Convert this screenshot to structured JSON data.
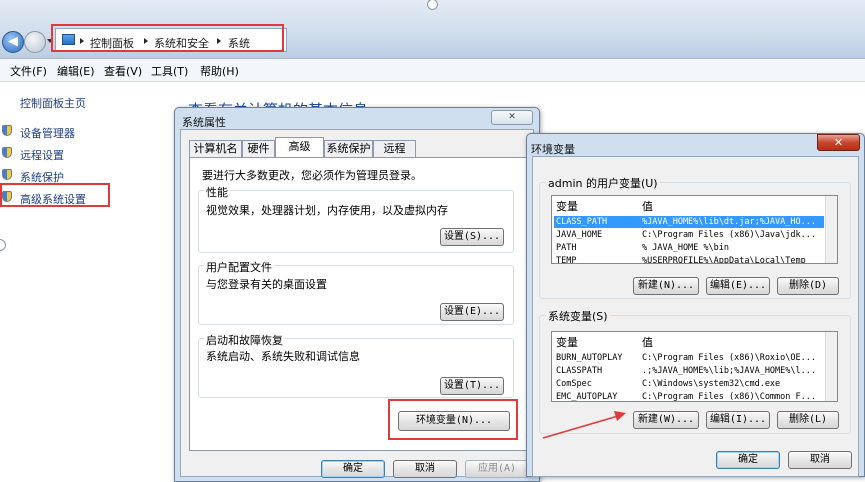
{
  "breadcrumb": [
    "控制面板",
    "系统和安全",
    "系统"
  ],
  "menu": [
    "文件(F)",
    "编辑(E)",
    "查看(V)",
    "工具(T)",
    "帮助(H)"
  ],
  "sidebar": {
    "home": "控制面板主页",
    "items": [
      "设备管理器",
      "远程设置",
      "系统保护",
      "高级系统设置"
    ]
  },
  "background_heading": "查看有关计算机的基本信息",
  "system_properties": {
    "title": "系统属性",
    "tabs": [
      "计算机名",
      "硬件",
      "高级",
      "系统保护",
      "远程"
    ],
    "active_tab": "高级",
    "admin_note": "要进行大多数更改，您必须作为管理员登录。",
    "performance": {
      "label": "性能",
      "desc": "视觉效果，处理器计划，内存使用，以及虚拟内存",
      "button": "设置(S)..."
    },
    "user_profiles": {
      "label": "用户配置文件",
      "desc": "与您登录有关的桌面设置",
      "button": "设置(E)..."
    },
    "startup_recovery": {
      "label": "启动和故障恢复",
      "desc": "系统启动、系统失败和调试信息",
      "button": "设置(T)..."
    },
    "env_button": "环境变量(N)...",
    "ok": "确定",
    "cancel": "取消",
    "apply": "应用(A)"
  },
  "env_vars": {
    "title": "环境变量",
    "user_group": "admin 的用户变量(U)",
    "system_group": "系统变量(S)",
    "col_var": "变量",
    "col_val": "值",
    "user_rows": [
      {
        "name": "CLASS_PATH",
        "value": "%JAVA_HOME%\\lib\\dt.jar;%JAVA_HO..."
      },
      {
        "name": "JAVA_HOME",
        "value": "C:\\Program Files (x86)\\Java\\jdk..."
      },
      {
        "name": "PATH",
        "value": "% JAVA_HOME %\\bin"
      },
      {
        "name": "TEMP",
        "value": "%USERPROFILE%\\AppData\\Local\\Temp"
      }
    ],
    "system_rows": [
      {
        "name": "BURN_AUTOPLAY",
        "value": "C:\\Program Files (x86)\\Roxio\\OE..."
      },
      {
        "name": "CLASSPATH",
        "value": ".;%JAVA_HOME%\\lib;%JAVA_HOME%\\l..."
      },
      {
        "name": "ComSpec",
        "value": "C:\\Windows\\system32\\cmd.exe"
      },
      {
        "name": "EMC_AUTOPLAY",
        "value": "C:\\Program Files (x86)\\Common F..."
      }
    ],
    "user_buttons": [
      "新建(N)...",
      "编辑(E)...",
      "删除(D)"
    ],
    "system_buttons": [
      "新建(W)...",
      "编辑(I)...",
      "删除(L)"
    ],
    "ok": "确定",
    "cancel": "取消"
  },
  "colors": {
    "highlight": "#e03a3a",
    "selection": "#3399ff",
    "link": "#1e3f8a"
  }
}
